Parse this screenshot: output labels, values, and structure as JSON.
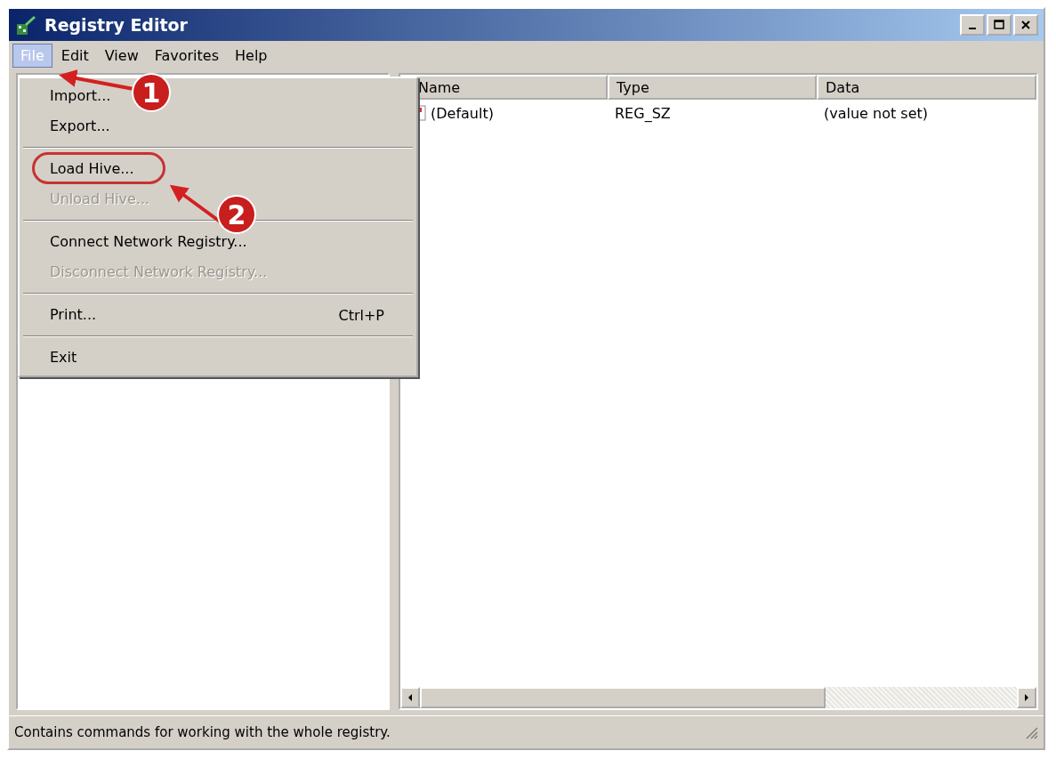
{
  "window": {
    "title": "Registry Editor"
  },
  "menu_bar": [
    {
      "label": "File",
      "selected": true
    },
    {
      "label": "Edit",
      "selected": false
    },
    {
      "label": "View",
      "selected": false
    },
    {
      "label": "Favorites",
      "selected": false
    },
    {
      "label": "Help",
      "selected": false
    }
  ],
  "file_menu": {
    "items": [
      {
        "kind": "item",
        "label": "Import...",
        "disabled": false,
        "circled": false
      },
      {
        "kind": "item",
        "label": "Export...",
        "disabled": false,
        "circled": false
      },
      {
        "kind": "separator"
      },
      {
        "kind": "item",
        "label": "Load Hive...",
        "disabled": false,
        "circled": true
      },
      {
        "kind": "item",
        "label": "Unload Hive...",
        "disabled": true,
        "circled": false
      },
      {
        "kind": "separator"
      },
      {
        "kind": "item",
        "label": "Connect Network Registry...",
        "disabled": false,
        "circled": false
      },
      {
        "kind": "item",
        "label": "Disconnect Network Registry...",
        "disabled": true,
        "circled": false
      },
      {
        "kind": "separator"
      },
      {
        "kind": "item",
        "label": "Print...",
        "shortcut": "Ctrl+P",
        "disabled": false,
        "circled": false
      },
      {
        "kind": "separator"
      },
      {
        "kind": "item",
        "label": "Exit",
        "disabled": false,
        "circled": false
      }
    ]
  },
  "values_list": {
    "columns": [
      "Name",
      "Type",
      "Data"
    ],
    "rows": [
      {
        "name": "(Default)",
        "type": "REG_SZ",
        "data": "(value not set)"
      }
    ]
  },
  "status_bar": {
    "text": "Contains commands for working with the whole registry."
  },
  "annotations": [
    {
      "label": "1"
    },
    {
      "label": "2"
    }
  ]
}
